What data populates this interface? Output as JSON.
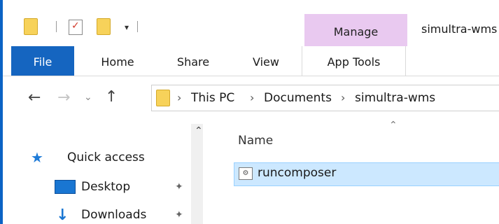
{
  "window": {
    "title": "simultra-wms"
  },
  "quick_access_toolbar": {
    "icons": [
      "folder-icon",
      "properties-icon",
      "new-folder-icon",
      "customize-dropdown-icon"
    ],
    "dropdown_glyph": "▾"
  },
  "contextual_tab": {
    "label": "Manage"
  },
  "ribbon": {
    "tabs": [
      {
        "label": "File",
        "active": true
      },
      {
        "label": "Home"
      },
      {
        "label": "Share"
      },
      {
        "label": "View"
      },
      {
        "label": "App Tools"
      }
    ]
  },
  "navigation": {
    "back_glyph": "←",
    "forward_glyph": "→",
    "recent_glyph": "⌄",
    "up_glyph": "↑"
  },
  "address_bar": {
    "separator": "›",
    "breadcrumbs": [
      "This PC",
      "Documents",
      "simultra-wms"
    ]
  },
  "nav_pane": {
    "scroll_up_glyph": "⌃",
    "items": [
      {
        "label": "Quick access",
        "icon": "star-icon"
      },
      {
        "label": "Desktop",
        "icon": "desktop-icon",
        "pinned": true
      },
      {
        "label": "Downloads",
        "icon": "download-icon",
        "pinned": true
      }
    ],
    "pin_glyph": "📌"
  },
  "file_list": {
    "sort_glyph": "⌃",
    "columns": [
      "Name"
    ],
    "rows": [
      {
        "name": "runcomposer",
        "selected": true,
        "icon": "executable-icon"
      }
    ]
  },
  "colors": {
    "accent_blue": "#1565c0",
    "manage_tab_bg": "#e9c9f0",
    "selection_bg": "#cce8ff",
    "folder_yellow": "#f7d25a"
  }
}
